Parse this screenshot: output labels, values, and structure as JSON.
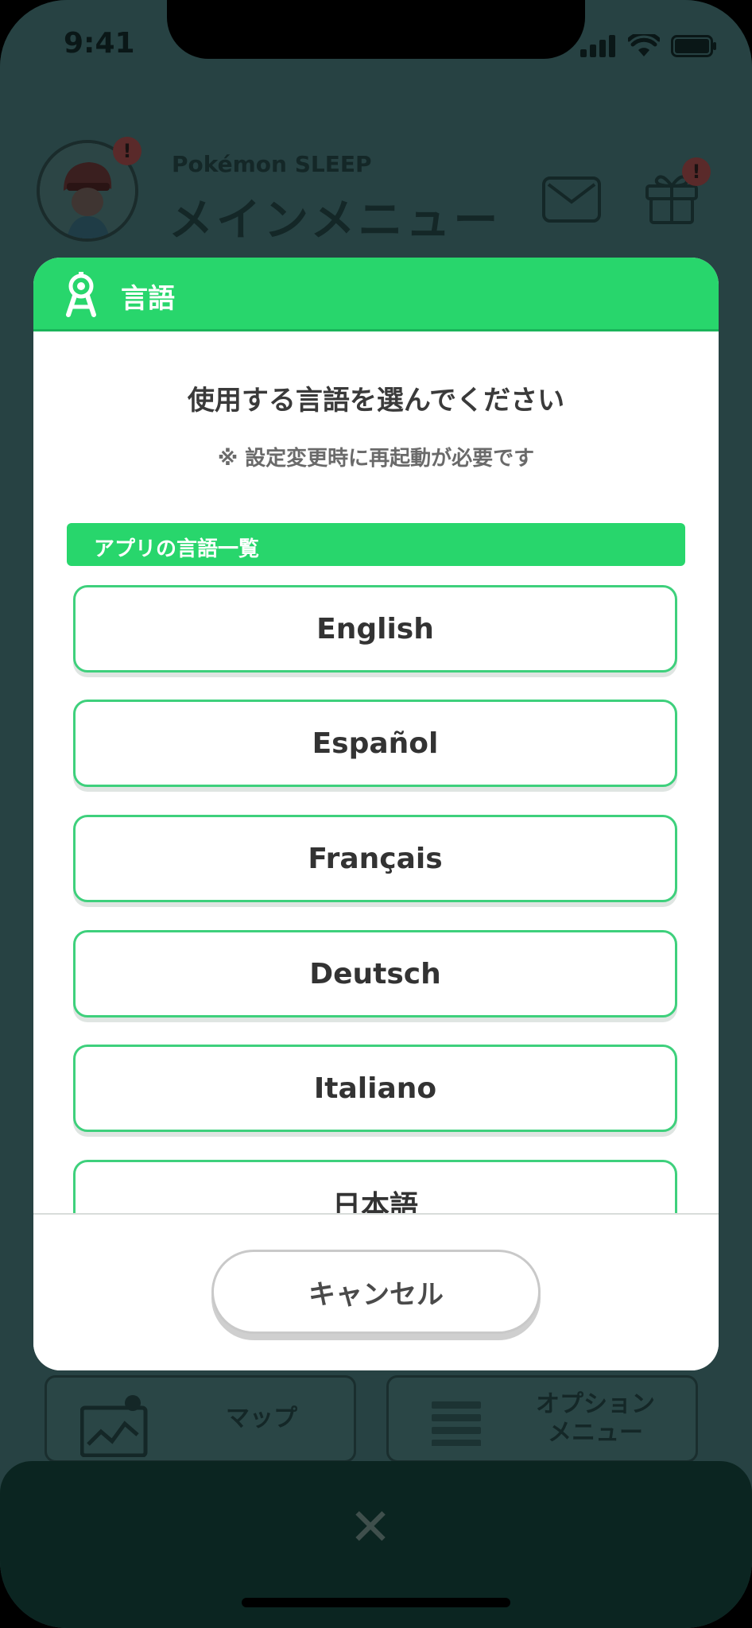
{
  "status_bar": {
    "time": "9:41",
    "icons": [
      "signal-icon",
      "wifi-icon",
      "battery-icon"
    ]
  },
  "background_app": {
    "brand": "Pokémon SLEEP",
    "title": "メインメニュー",
    "avatar_badge": "!",
    "gift_badge": "!",
    "cards": [
      {
        "label": "マップ",
        "icon": "map-icon"
      },
      {
        "label": "オプション\nメニュー",
        "icon": "list-icon"
      }
    ],
    "close_icon": "✕"
  },
  "modal": {
    "title": "言語",
    "header_icon": "compass-icon",
    "prompt": "使用する言語を選んでください",
    "note": "※ 設定変更時に再起動が必要です",
    "section_label": "アプリの言語一覧",
    "languages": [
      "English",
      "Español",
      "Français",
      "Deutsch",
      "Italiano",
      "日本語"
    ],
    "cancel_label": "キャンセル"
  },
  "colors": {
    "accent_green": "#28d66c",
    "button_border": "#3ed07c",
    "dim_background": "#274243",
    "bottom_bar": "#0b2521"
  }
}
